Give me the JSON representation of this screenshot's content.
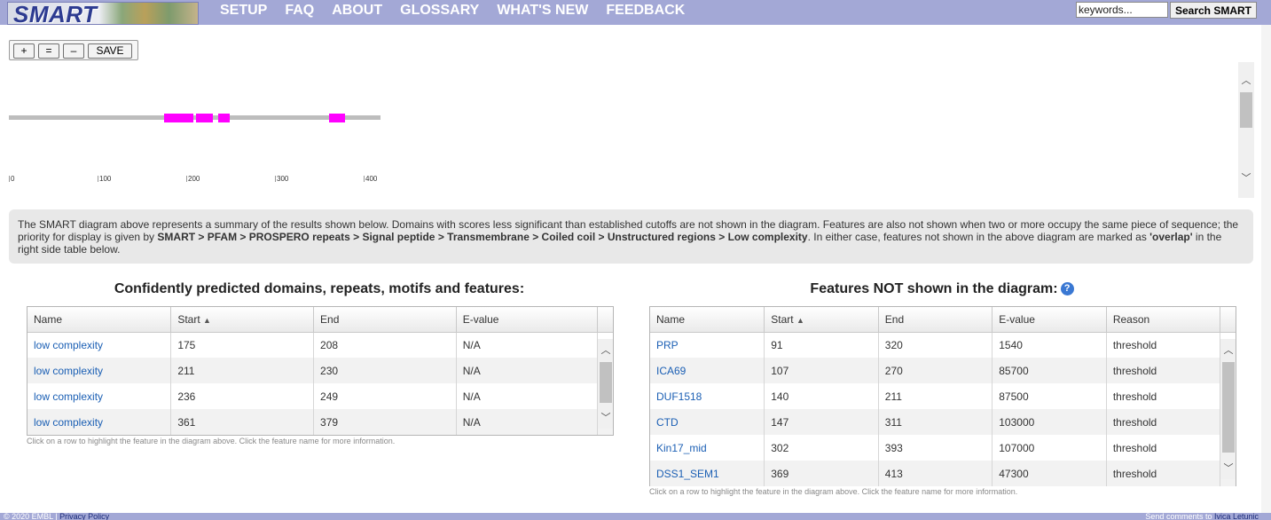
{
  "header": {
    "logo_text": "SMART",
    "nav": [
      "SETUP",
      "FAQ",
      "ABOUT",
      "GLOSSARY",
      "WHAT'S NEW",
      "FEEDBACK"
    ],
    "search_placeholder": "keywords...",
    "search_button": "Search SMART"
  },
  "toolbar": {
    "zoom_in": "+",
    "zoom_reset": "=",
    "zoom_out": "–",
    "save": "SAVE"
  },
  "diagram": {
    "sequence_length": 419,
    "domains": [
      {
        "name": "low complexity",
        "start": 175,
        "end": 208
      },
      {
        "name": "low complexity",
        "start": 211,
        "end": 230
      },
      {
        "name": "low complexity",
        "start": 236,
        "end": 249
      },
      {
        "name": "low complexity",
        "start": 361,
        "end": 379
      }
    ],
    "ticks": [
      "0",
      "100",
      "200",
      "300",
      "400"
    ],
    "domain_color": "#ff00ff"
  },
  "description": {
    "text1": "The SMART diagram above represents a summary of the results shown below. Domains with scores less significant than established cutoffs are not shown in the diagram. Features are also not shown when two or more occupy the same piece of sequence; the priority for display is given by ",
    "priority": "SMART > PFAM > PROSPERO repeats > Signal peptide > Transmembrane > Coiled coil > Unstructured regions > Low complexity",
    "text2": ". In either case, features not shown in the above diagram are marked as ",
    "overlap": "'overlap'",
    "text3": " in the right side table below."
  },
  "confident_table": {
    "title": "Confidently predicted domains, repeats, motifs and features:",
    "columns": [
      "Name",
      "Start",
      "End",
      "E-value"
    ],
    "sort_indicator": "▲",
    "rows": [
      {
        "name": "low complexity",
        "start": "175",
        "end": "208",
        "evalue": "N/A"
      },
      {
        "name": "low complexity",
        "start": "211",
        "end": "230",
        "evalue": "N/A"
      },
      {
        "name": "low complexity",
        "start": "236",
        "end": "249",
        "evalue": "N/A"
      },
      {
        "name": "low complexity",
        "start": "361",
        "end": "379",
        "evalue": "N/A"
      }
    ],
    "hint": "Click on a row to highlight the feature in the diagram above. Click the feature name for more information."
  },
  "not_shown_table": {
    "title": "Features NOT shown in the diagram:",
    "help_glyph": "?",
    "columns": [
      "Name",
      "Start",
      "End",
      "E-value",
      "Reason"
    ],
    "sort_indicator": "▲",
    "rows": [
      {
        "name": "PRP",
        "start": "91",
        "end": "320",
        "evalue": "1540",
        "reason": "threshold"
      },
      {
        "name": "ICA69",
        "start": "107",
        "end": "270",
        "evalue": "85700",
        "reason": "threshold"
      },
      {
        "name": "DUF1518",
        "start": "140",
        "end": "211",
        "evalue": "87500",
        "reason": "threshold"
      },
      {
        "name": "CTD",
        "start": "147",
        "end": "311",
        "evalue": "103000",
        "reason": "threshold"
      },
      {
        "name": "Kin17_mid",
        "start": "302",
        "end": "393",
        "evalue": "107000",
        "reason": "threshold"
      },
      {
        "name": "DSS1_SEM1",
        "start": "369",
        "end": "413",
        "evalue": "47300",
        "reason": "threshold"
      }
    ],
    "hint": "Click on a row to highlight the feature in the diagram above. Click the feature name for more information."
  },
  "footer": {
    "copyright": "© 2020 EMBL | ",
    "privacy": "Privacy Policy",
    "comments": "Send comments to ",
    "author": "Ivica Letunic"
  }
}
